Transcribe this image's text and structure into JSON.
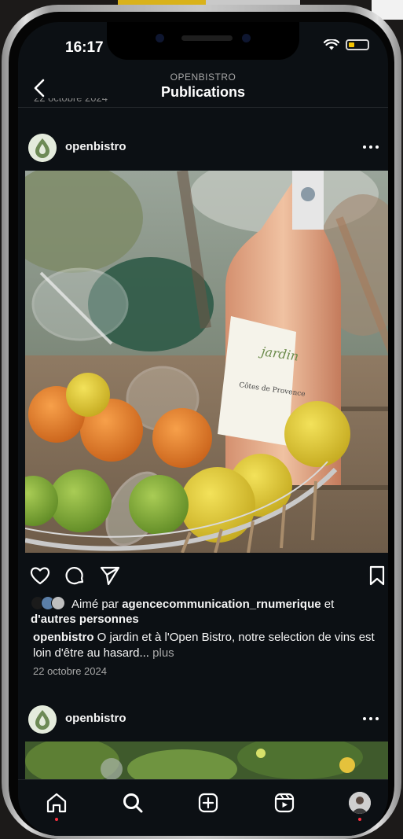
{
  "status_bar": {
    "time": "16:17"
  },
  "header": {
    "account": "OPENBISTRO",
    "title": "Publications",
    "previous_date_cut": "22 octobre 2024"
  },
  "posts": [
    {
      "username": "openbistro",
      "liked_by_prefix": "Aimé par ",
      "liked_by_user": "agencecommunication_rnumerique",
      "liked_by_joiner": " et ",
      "liked_by_others": "d'autres personnes",
      "caption_user": "openbistro",
      "caption_text": " O jardin et à l'Open Bistro, notre selection de vins est loin d'être au hasard...",
      "caption_more": "plus",
      "date": "22 octobre 2024",
      "image_subject": "rosé wine bottle with glasses and citrus fruit basket",
      "bottle_label": "Côtes de Provence",
      "bottle_brand": "jardin"
    },
    {
      "username": "openbistro"
    }
  ],
  "icons": {
    "back": "chevron-left-icon",
    "more": "more-horizontal-icon",
    "like": "heart-icon",
    "comment": "comment-icon",
    "share": "send-icon",
    "save": "bookmark-icon",
    "home": "home-icon",
    "search": "search-icon",
    "create": "plus-square-icon",
    "reels": "reels-icon",
    "profile": "profile-avatar"
  },
  "colors": {
    "background": "#0c1014",
    "text": "#f5f5f5",
    "secondary_text": "#a8a8a8",
    "notification_dot": "#ff3040",
    "battery": "#f5c400"
  }
}
